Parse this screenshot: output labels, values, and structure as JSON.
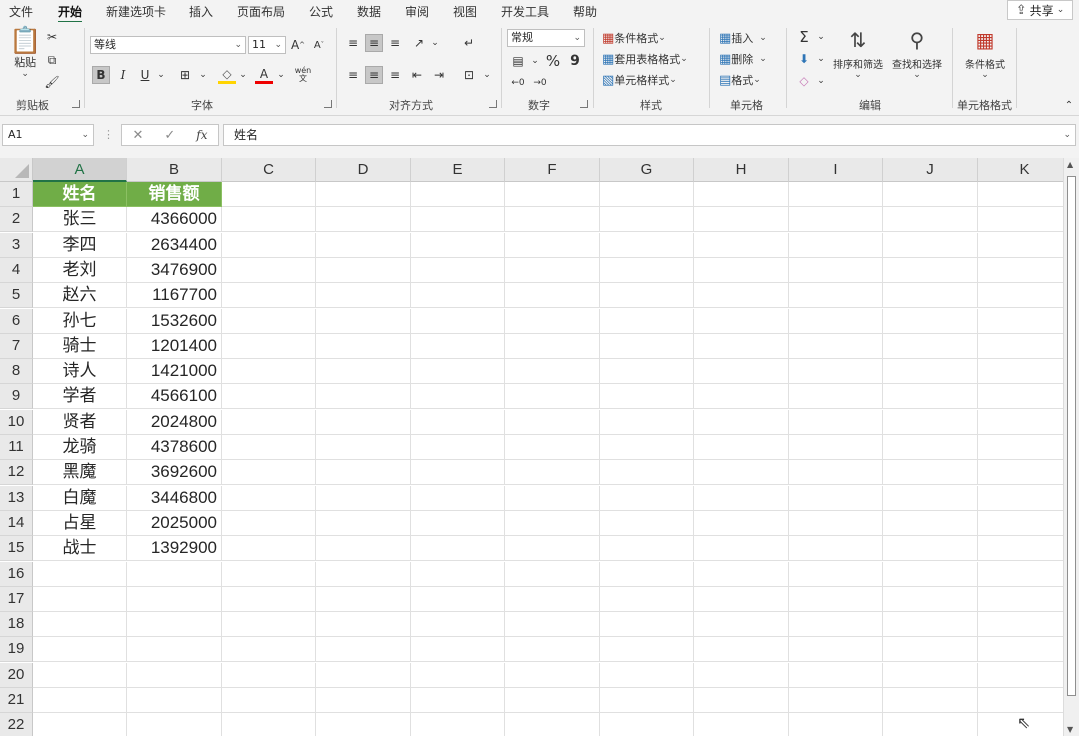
{
  "menu": {
    "tabs": [
      "文件",
      "开始",
      "新建选项卡",
      "插入",
      "页面布局",
      "公式",
      "数据",
      "审阅",
      "视图",
      "开发工具",
      "帮助"
    ],
    "active_tab": "开始",
    "share_label": "共享"
  },
  "ribbon": {
    "clipboard": {
      "paste_label": "粘贴",
      "group_label": "剪贴板"
    },
    "font": {
      "font_name": "等线",
      "font_size": "11",
      "group_label": "字体",
      "bold": "B",
      "italic": "I",
      "underline": "U",
      "grow": "A",
      "shrink": "A",
      "font_color": "A",
      "phonetic": "wén"
    },
    "alignment": {
      "group_label": "对齐方式"
    },
    "number": {
      "format": "常规",
      "percent": "%",
      "comma": "9",
      "group_label": "数字"
    },
    "styles": {
      "conditional": "条件格式",
      "table_format": "套用表格格式",
      "cell_styles": "单元格样式",
      "group_label": "样式"
    },
    "cells": {
      "insert": "插入",
      "delete": "删除",
      "format": "格式",
      "group_label": "单元格"
    },
    "editing": {
      "sort_filter": "排序和筛选",
      "find_select": "查找和选择",
      "group_label": "编辑"
    },
    "cell_format": {
      "label": "条件格式",
      "group_label": "单元格格式"
    }
  },
  "formula_bar": {
    "name_box": "A1",
    "fx": "fx",
    "content": "姓名"
  },
  "sheet": {
    "columns": [
      "A",
      "B",
      "C",
      "D",
      "E",
      "F",
      "G",
      "H",
      "I",
      "J",
      "K"
    ],
    "rows": [
      "1",
      "2",
      "3",
      "4",
      "5",
      "6",
      "7",
      "8",
      "9",
      "10",
      "11",
      "12",
      "13",
      "14",
      "15",
      "16",
      "17",
      "18",
      "19",
      "20",
      "21",
      "22"
    ],
    "header": [
      "姓名",
      "销售额"
    ],
    "data": [
      [
        "张三",
        "4366000"
      ],
      [
        "李四",
        "2634400"
      ],
      [
        "老刘",
        "3476900"
      ],
      [
        "赵六",
        "1167700"
      ],
      [
        "孙七",
        "1532600"
      ],
      [
        "骑士",
        "1201400"
      ],
      [
        "诗人",
        "1421000"
      ],
      [
        "学者",
        "4566100"
      ],
      [
        "贤者",
        "2024800"
      ],
      [
        "龙骑",
        "4378600"
      ],
      [
        "黑魔",
        "3692600"
      ],
      [
        "白魔",
        "3446800"
      ],
      [
        "占星",
        "2025000"
      ],
      [
        "战士",
        "1392900"
      ]
    ]
  },
  "colors": {
    "accent": "#217346",
    "header_fill": "#70ad47"
  }
}
